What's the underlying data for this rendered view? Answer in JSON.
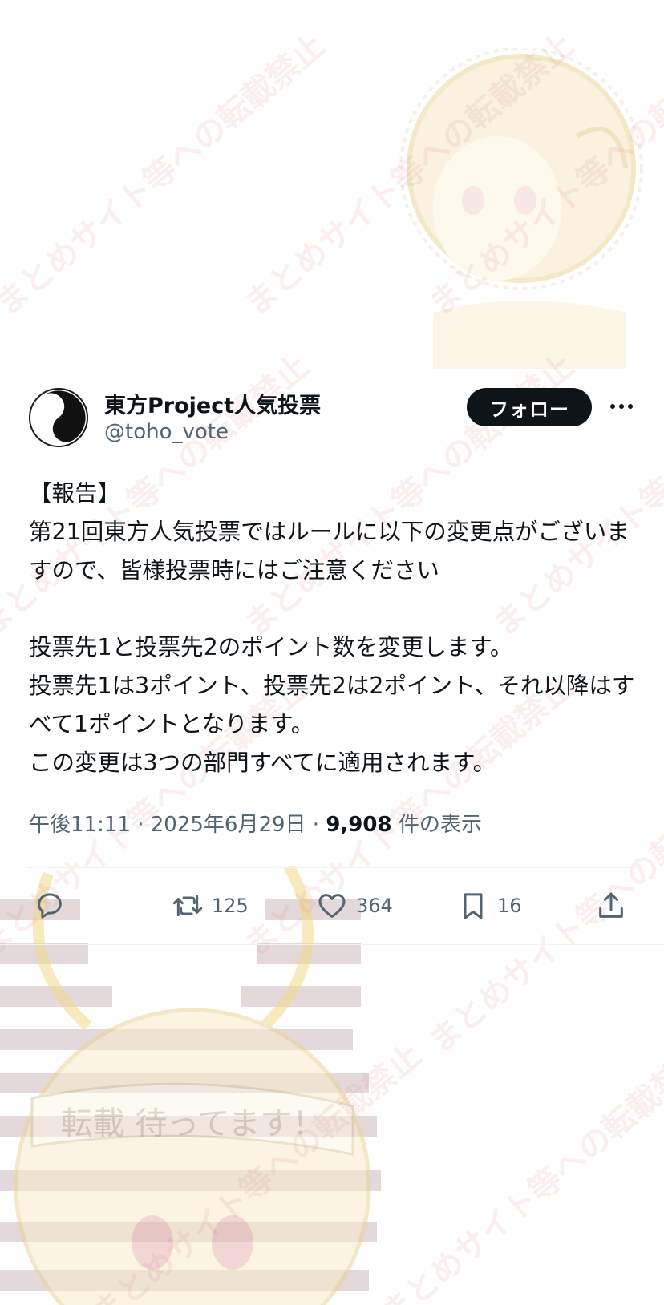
{
  "tweet": {
    "display_name": "東方Project人気投票",
    "handle": "@toho_vote",
    "follow_label": "フォロー",
    "body": "【報告】\n第21回東方人気投票ではルールに以下の変更点がございますので、皆様投票時にはご注意ください\n\n投票先1と投票先2のポイント数を変更します。\n投票先1は3ポイント、投票先2は2ポイント、それ以降はすべて1ポイントとなります。\nこの変更は3つの部門すべてに適用されます。",
    "time": "午後11:11",
    "date": "2025年6月29日",
    "views_count": "9,908",
    "views_label": "件の表示",
    "retweets": "125",
    "likes": "364",
    "bookmarks": "16"
  },
  "watermark": {
    "text": "まとめサイト等への転載禁止",
    "sign_text": "転載 待ってます！"
  },
  "icons": {
    "avatar": "yin-yang-icon",
    "more": "more-horizontal-icon",
    "reply": "reply-icon",
    "retweet": "retweet-icon",
    "like": "heart-icon",
    "bookmark": "bookmark-icon",
    "share": "share-icon"
  },
  "colors": {
    "text_primary": "#0f1419",
    "text_secondary": "#536471",
    "follow_button_bg": "#0f1419",
    "divider": "#eff3f4"
  }
}
